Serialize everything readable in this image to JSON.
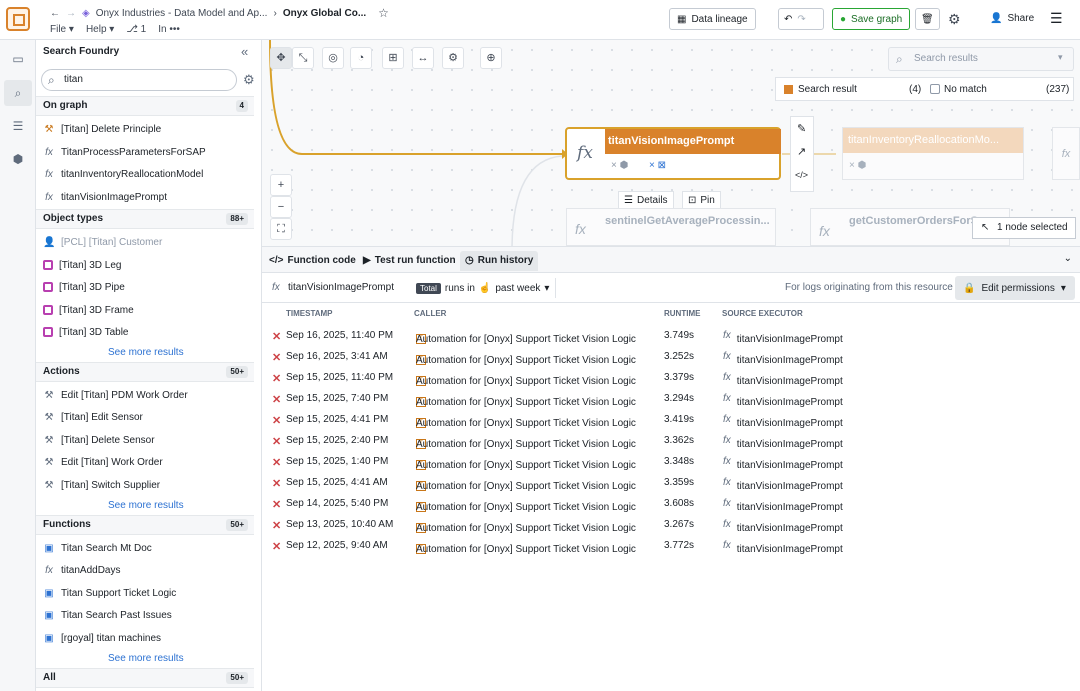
{
  "header": {
    "crumb1": "Onyx Industries - Data Model and Ap...",
    "crumb2": "Onyx Global Co...",
    "menu": [
      "File",
      "Help"
    ],
    "meta": "1",
    "meta2": "In",
    "data_lineage": "Data lineage",
    "save": "Save graph",
    "share": "Share"
  },
  "panel": {
    "title": "Search Foundry",
    "query": "titan",
    "on_graph": {
      "label": "On graph",
      "count": "4",
      "items": [
        "[Titan] Delete Principle",
        "TitanProcessParametersForSAP",
        "titanInventoryReallocationModel",
        "titanVisionImagePrompt"
      ]
    },
    "object_types": {
      "label": "Object types",
      "count": "88+",
      "items": [
        "[PCL] [Titan] Customer",
        "[Titan] 3D Leg",
        "[Titan] 3D Pipe",
        "[Titan] 3D Frame",
        "[Titan] 3D Table"
      ],
      "more": "See more results"
    },
    "actions": {
      "label": "Actions",
      "count": "50+",
      "items": [
        "Edit [Titan] PDM Work Order",
        "[Titan] Edit Sensor",
        "[Titan] Delete Sensor",
        "Edit [Titan] Work Order",
        "[Titan] Switch Supplier"
      ],
      "more": "See more results"
    },
    "functions": {
      "label": "Functions",
      "count": "50+",
      "items": [
        "Titan Search Mt Doc",
        "titanAddDays",
        "Titan Support Ticket Logic",
        "Titan Search Past Issues",
        "[rgoyal] titan machines"
      ],
      "more": "See more results"
    },
    "all": {
      "label": "All",
      "count": "50+"
    }
  },
  "canvas": {
    "search_placeholder": "Search results",
    "legend_result": "Search result",
    "legend_result_count": "(4)",
    "legend_nomatch": "No match",
    "legend_nomatch_count": "(237)",
    "main_node": "titanVisionImagePrompt",
    "node2": "titanInventoryReallocationMo...",
    "node3": "sentinelGetAverageProcessin...",
    "node4": "getCustomerOrdersForSensor",
    "details": "Details",
    "pin": "Pin",
    "selected": "1 node selected"
  },
  "bottom": {
    "tabs": [
      "Function code",
      "Test run function",
      "Run history"
    ],
    "function_name": "titanVisionImagePrompt",
    "pill": "Total",
    "runs_in": "runs in",
    "period": "past week",
    "logs_text": "For logs originating from this resource",
    "edit_perm": "Edit permissions",
    "columns": [
      "TIMESTAMP",
      "CALLER",
      "RUNTIME",
      "SOURCE EXECUTOR"
    ],
    "rows": [
      {
        "ts": "Sep 16, 2025, 11:40 PM",
        "caller": "Automation for [Onyx] Support Ticket Vision Logic",
        "rt": "3.749s",
        "src": "titanVisionImagePrompt"
      },
      {
        "ts": "Sep 16, 2025, 3:41 AM",
        "caller": "Automation for [Onyx] Support Ticket Vision Logic",
        "rt": "3.252s",
        "src": "titanVisionImagePrompt"
      },
      {
        "ts": "Sep 15, 2025, 11:40 PM",
        "caller": "Automation for [Onyx] Support Ticket Vision Logic",
        "rt": "3.379s",
        "src": "titanVisionImagePrompt"
      },
      {
        "ts": "Sep 15, 2025, 7:40 PM",
        "caller": "Automation for [Onyx] Support Ticket Vision Logic",
        "rt": "3.294s",
        "src": "titanVisionImagePrompt"
      },
      {
        "ts": "Sep 15, 2025, 4:41 PM",
        "caller": "Automation for [Onyx] Support Ticket Vision Logic",
        "rt": "3.419s",
        "src": "titanVisionImagePrompt"
      },
      {
        "ts": "Sep 15, 2025, 2:40 PM",
        "caller": "Automation for [Onyx] Support Ticket Vision Logic",
        "rt": "3.362s",
        "src": "titanVisionImagePrompt"
      },
      {
        "ts": "Sep 15, 2025, 1:40 PM",
        "caller": "Automation for [Onyx] Support Ticket Vision Logic",
        "rt": "3.348s",
        "src": "titanVisionImagePrompt"
      },
      {
        "ts": "Sep 15, 2025, 4:41 AM",
        "caller": "Automation for [Onyx] Support Ticket Vision Logic",
        "rt": "3.359s",
        "src": "titanVisionImagePrompt"
      },
      {
        "ts": "Sep 14, 2025, 5:40 PM",
        "caller": "Automation for [Onyx] Support Ticket Vision Logic",
        "rt": "3.608s",
        "src": "titanVisionImagePrompt"
      },
      {
        "ts": "Sep 13, 2025, 10:40 AM",
        "caller": "Automation for [Onyx] Support Ticket Vision Logic",
        "rt": "3.267s",
        "src": "titanVisionImagePrompt"
      },
      {
        "ts": "Sep 12, 2025, 9:40 AM",
        "caller": "Automation for [Onyx] Support Ticket Vision Logic",
        "rt": "3.772s",
        "src": "titanVisionImagePrompt"
      }
    ]
  }
}
